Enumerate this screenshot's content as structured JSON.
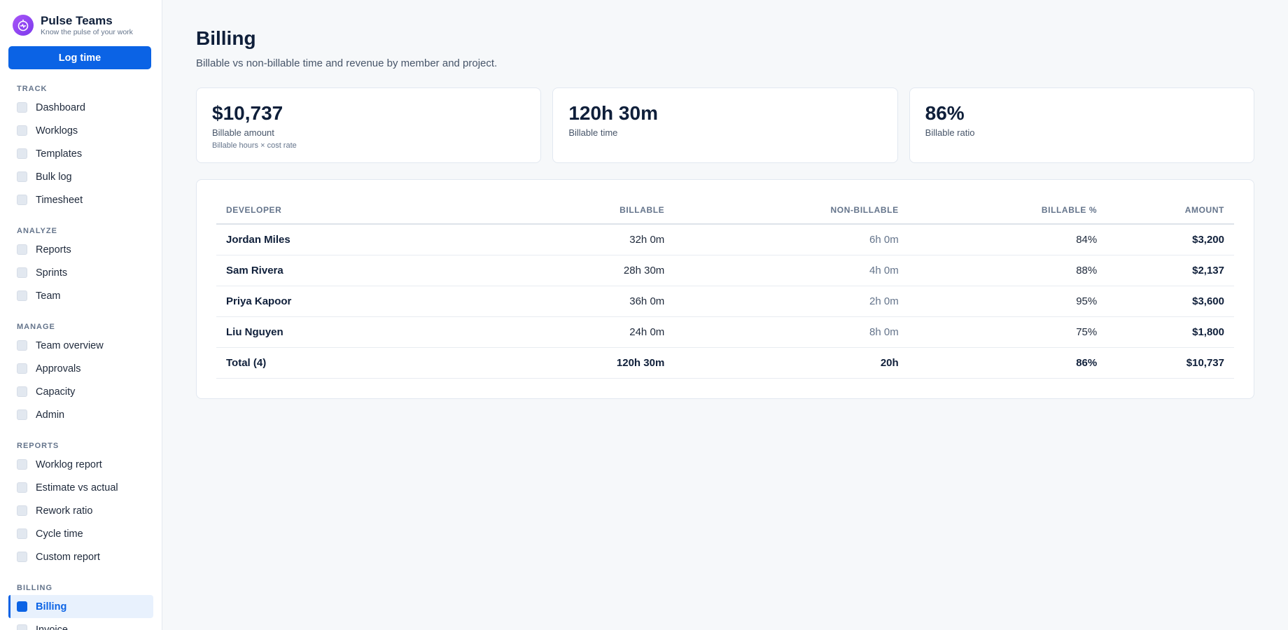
{
  "brand": {
    "title": "Pulse Teams",
    "subtitle": "Know the pulse of your work"
  },
  "actions": {
    "log_time_label": "Log time"
  },
  "nav": {
    "track": {
      "heading": "TRACK",
      "items": [
        "Dashboard",
        "Worklogs",
        "Templates",
        "Bulk log",
        "Timesheet"
      ]
    },
    "analyze": {
      "heading": "ANALYZE",
      "items": [
        "Reports",
        "Sprints",
        "Team"
      ]
    },
    "manage": {
      "heading": "MANAGE",
      "items": [
        "Team overview",
        "Approvals",
        "Capacity",
        "Admin"
      ]
    },
    "reports": {
      "heading": "REPORTS",
      "items": [
        "Worklog report",
        "Estimate vs actual",
        "Rework ratio",
        "Cycle time",
        "Custom report"
      ]
    },
    "billing": {
      "heading": "BILLING",
      "items": [
        "Billing",
        "Invoice"
      ],
      "active": "Billing"
    }
  },
  "page": {
    "title": "Billing",
    "subtitle": "Billable vs non-billable time and revenue by member and project."
  },
  "stats": [
    {
      "value": "$10,737",
      "label": "Billable amount",
      "note": "Billable hours × cost rate"
    },
    {
      "value": "120h 30m",
      "label": "Billable time",
      "note": ""
    },
    {
      "value": "86%",
      "label": "Billable ratio",
      "note": ""
    }
  ],
  "table": {
    "headers": [
      "DEVELOPER",
      "BILLABLE",
      "NON-BILLABLE",
      "BILLABLE %",
      "AMOUNT"
    ],
    "rows": [
      [
        "Jordan Miles",
        "32h 0m",
        "6h 0m",
        "84%",
        "$3,200"
      ],
      [
        "Sam Rivera",
        "28h 30m",
        "4h 0m",
        "88%",
        "$2,137"
      ],
      [
        "Priya Kapoor",
        "36h 0m",
        "2h 0m",
        "95%",
        "$3,600"
      ],
      [
        "Liu Nguyen",
        "24h 0m",
        "8h 0m",
        "75%",
        "$1,800"
      ]
    ],
    "total": [
      "Total (4)",
      "120h 30m",
      "20h",
      "86%",
      "$10,737"
    ]
  },
  "colors": {
    "accent": "#0b63e5",
    "brand_logo": "#8b5cf6",
    "text_dark": "#0f1f3a"
  },
  "icons": {
    "brand": "pulse-timer-icon",
    "nav": "square-icon"
  }
}
